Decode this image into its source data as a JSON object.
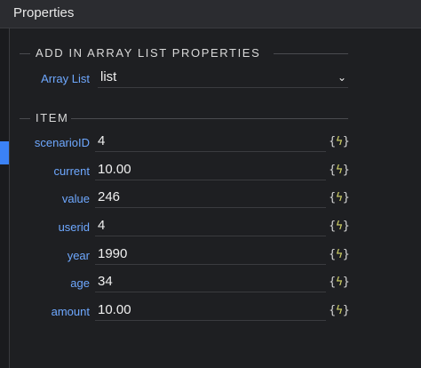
{
  "header": {
    "title": "Properties"
  },
  "add_section": {
    "title": "ADD IN ARRAY LIST PROPERTIES",
    "array_list_label": "Array List",
    "array_list_value": "list"
  },
  "item_section": {
    "title": "ITEM",
    "rows": [
      {
        "label": "scenarioID",
        "value": "4"
      },
      {
        "label": "current",
        "value": "10.00"
      },
      {
        "label": "value",
        "value": "246"
      },
      {
        "label": "userid",
        "value": "4"
      },
      {
        "label": "year",
        "value": "1990"
      },
      {
        "label": "age",
        "value": "34"
      },
      {
        "label": "amount",
        "value": "10.00"
      }
    ]
  },
  "binding_icon": {
    "name": "dynamic-binding-icon",
    "left": "{",
    "bolt": "ϟ",
    "right": "}"
  },
  "colors": {
    "label": "#6ea8ff",
    "accent": "#3b82f6",
    "bolt": "#d6d66a"
  }
}
